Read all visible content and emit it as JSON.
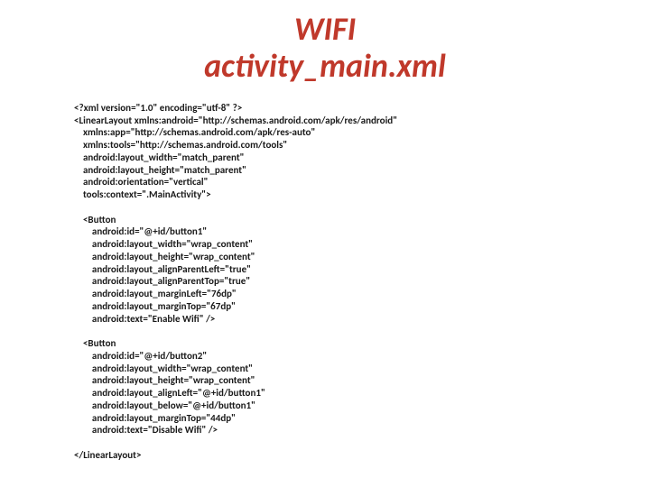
{
  "title": {
    "line1": "WIFI",
    "line2": "activity_main.xml"
  },
  "code": "<?xml version=\"1.0\" encoding=\"utf-8\" ?>\n<LinearLayout xmlns:android=\"http://schemas.android.com/apk/res/android\"\n    xmlns:app=\"http://schemas.android.com/apk/res-auto\"\n    xmlns:tools=\"http://schemas.android.com/tools\"\n    android:layout_width=\"match_parent\"\n    android:layout_height=\"match_parent\"\n    android:orientation=\"vertical\"\n    tools:context=\".MainActivity\">\n\n    <Button\n        android:id=\"@+id/button1\"\n        android:layout_width=\"wrap_content\"\n        android:layout_height=\"wrap_content\"\n        android:layout_alignParentLeft=\"true\"\n        android:layout_alignParentTop=\"true\"\n        android:layout_marginLeft=\"76dp\"\n        android:layout_marginTop=\"67dp\"\n        android:text=\"Enable Wifi\" />\n\n    <Button\n        android:id=\"@+id/button2\"\n        android:layout_width=\"wrap_content\"\n        android:layout_height=\"wrap_content\"\n        android:layout_alignLeft=\"@+id/button1\"\n        android:layout_below=\"@+id/button1\"\n        android:layout_marginTop=\"44dp\"\n        android:text=\"Disable Wifi\" />\n\n</LinearLayout>"
}
